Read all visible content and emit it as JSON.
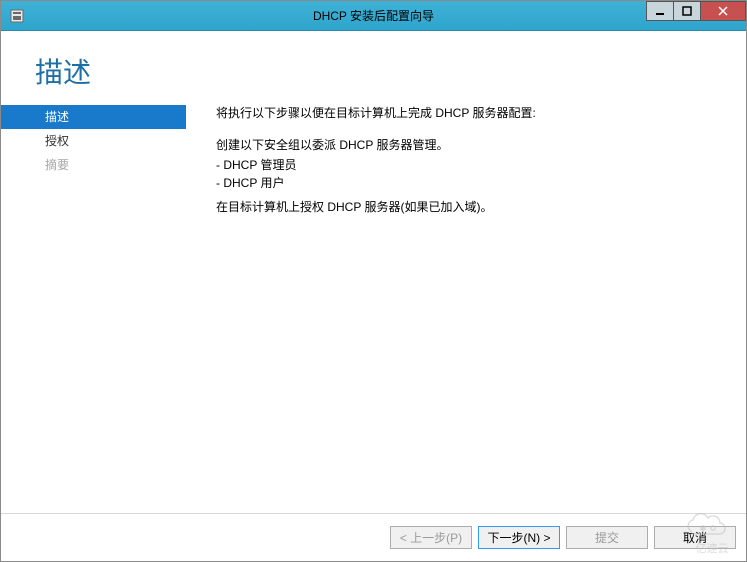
{
  "window": {
    "title": "DHCP 安装后配置向导"
  },
  "page": {
    "heading": "描述"
  },
  "sidebar": {
    "items": [
      {
        "label": "描述",
        "state": "selected"
      },
      {
        "label": "授权",
        "state": "normal"
      },
      {
        "label": "摘要",
        "state": "disabled"
      }
    ]
  },
  "content": {
    "intro": "将执行以下步骤以便在目标计算机上完成 DHCP 服务器配置:",
    "groups_line": "创建以下安全组以委派 DHCP 服务器管理。",
    "group1": "- DHCP 管理员",
    "group2": "- DHCP 用户",
    "authorize_line": "在目标计算机上授权 DHCP 服务器(如果已加入域)。"
  },
  "footer": {
    "previous": "< 上一步(P)",
    "next": "下一步(N) >",
    "commit": "提交",
    "cancel": "取消"
  },
  "watermark": "亿速云"
}
